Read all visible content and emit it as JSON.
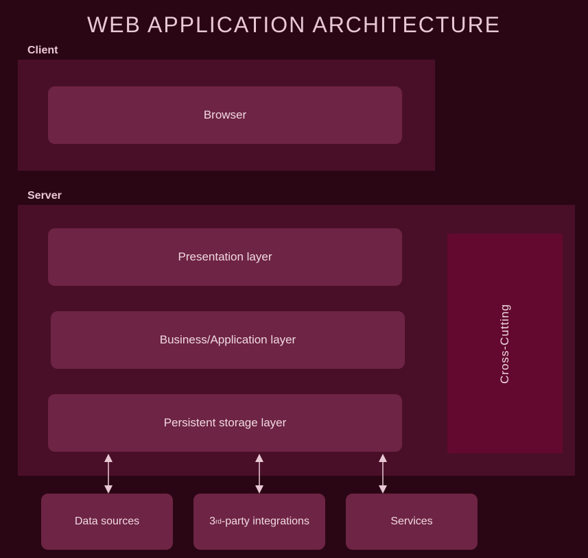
{
  "title": "WEB APPLICATION ARCHITECTURE",
  "sections": {
    "client": {
      "label": "Client",
      "browser": "Browser"
    },
    "server": {
      "label": "Server",
      "layers": [
        "Presentation layer",
        "Business/Application layer",
        "Persistent storage layer"
      ],
      "cross_cutting": "Cross-Cutting"
    },
    "bottom": {
      "data_sources": "Data sources",
      "third_party_prefix": "3",
      "third_party_sup": "rd",
      "third_party_suffix": "-party integrations",
      "services": "Services"
    }
  },
  "colors": {
    "background": "#2a0614",
    "container": "#4a0f28",
    "box": "#6e2444",
    "cross_cutting": "#63092f",
    "text": "#e8c8d4"
  }
}
